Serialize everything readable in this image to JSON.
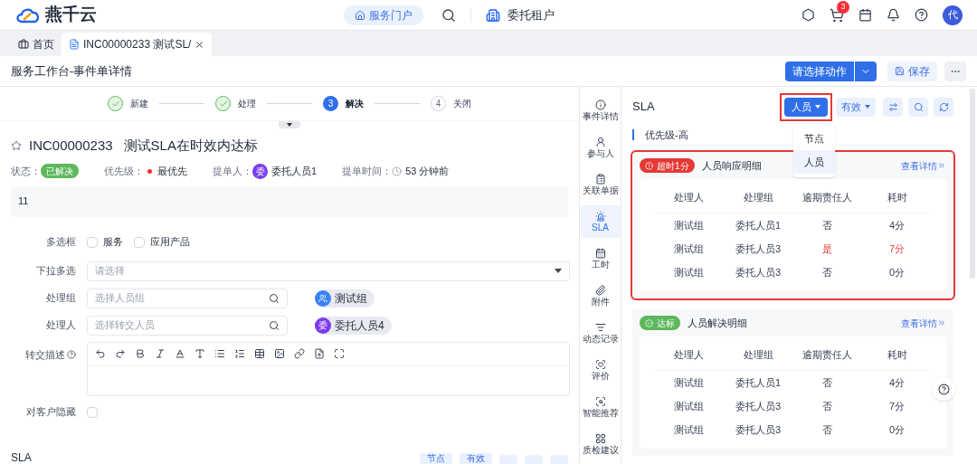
{
  "app": {
    "logo_text": "燕千云"
  },
  "top_bar": {
    "portal_button": "服务门户",
    "tenant": "委托租户",
    "cart_badge": "3",
    "avatar": "代"
  },
  "tabs": [
    {
      "label": "首页",
      "selected": false
    },
    {
      "label": "INC00000233 测试SL/",
      "selected": true
    }
  ],
  "page_header": {
    "title": "服务工作台-事件单详情",
    "action_button": "请选择动作",
    "save_button": "保存"
  },
  "steps": [
    {
      "label": "新建",
      "completed": true,
      "current": false
    },
    {
      "label": "处理",
      "completed": true,
      "current": false
    },
    {
      "number": "3",
      "label": "解决",
      "completed": false,
      "current": true
    },
    {
      "number": "4",
      "label": "关闭",
      "completed": false,
      "current": false
    }
  ],
  "ticket": {
    "starred": false,
    "id": "INC00000233",
    "title": "测试SLA在时效内达标",
    "status_label": "状态：",
    "status": "已解决",
    "priority_label": "优先级：",
    "priority": "最优先",
    "submitter_label": "提单人：",
    "submitter_avatar": "委",
    "submitter": "委托人员1",
    "time_label": "提单时间：",
    "time": "53 分钟前",
    "description": "11"
  },
  "form": [
    {
      "kind": "checkboxes",
      "label": "多选框",
      "options": [
        {
          "label": "服务",
          "checked": false
        },
        {
          "label": "应用产品",
          "checked": false
        }
      ]
    },
    {
      "kind": "select",
      "label": "下拉多选",
      "placeholder": "请选择"
    },
    {
      "kind": "search",
      "label": "处理组",
      "placeholder": "选择人员组",
      "chip": {
        "text": "测试组",
        "color": "#3b82f6"
      }
    },
    {
      "kind": "search",
      "label": "处理人",
      "placeholder": "选择转交人员",
      "chip": {
        "avatar_text": "委",
        "text": "委托人员4",
        "color": "#7c3aed"
      }
    },
    {
      "kind": "editor",
      "label": "转交描述"
    },
    {
      "kind": "checkbox",
      "label": "对客户隐藏",
      "checked": false
    }
  ],
  "bottom_sla": {
    "title": "SLA",
    "filter_buttons": [
      "节点",
      "有效"
    ]
  },
  "side_nav": [
    {
      "label": "事件详情",
      "selected": false
    },
    {
      "label": "参与人",
      "selected": false
    },
    {
      "label": "关联单据",
      "selected": false
    },
    {
      "label": "SLA",
      "selected": true
    },
    {
      "label": "工时",
      "selected": false
    },
    {
      "label": "附件",
      "selected": false
    },
    {
      "label": "动态记录",
      "selected": false
    },
    {
      "label": "评价",
      "selected": false
    },
    {
      "label": "智能推荐",
      "selected": false
    },
    {
      "label": "质检建议",
      "selected": false
    }
  ],
  "sla_panel": {
    "title": "SLA",
    "view_button": {
      "label": "人员",
      "highlighted": true
    },
    "status_button": "有效",
    "view_menu": [
      {
        "label": "节点",
        "selected": false
      },
      {
        "label": "人员",
        "selected": true
      }
    ],
    "priority": "优先级-高",
    "cards": [
      {
        "badge": "超时1分",
        "breached": true,
        "title": "人员响应明细",
        "link": "查看详情",
        "highlighted": true,
        "columns": [
          "处理人",
          "处理组",
          "逾期责任人",
          "耗时"
        ],
        "rows": [
          {
            "cells": [
              "测试组",
              "委托人员1",
              "否",
              "4分"
            ],
            "overdue": false
          },
          {
            "cells": [
              "测试组",
              "委托人员3",
              "是",
              "7分"
            ],
            "overdue": true
          },
          {
            "cells": [
              "测试组",
              "委托人员3",
              "否",
              "0分"
            ],
            "overdue": false
          }
        ]
      },
      {
        "badge": "达标",
        "breached": false,
        "title": "人员解决明细",
        "link": "查看详情",
        "highlighted": false,
        "columns": [
          "处理人",
          "处理组",
          "逾期责任人",
          "耗时"
        ],
        "rows": [
          {
            "cells": [
              "测试组",
              "委托人员1",
              "否",
              "4分"
            ],
            "overdue": false
          },
          {
            "cells": [
              "测试组",
              "委托人员3",
              "否",
              "7分"
            ],
            "overdue": false
          },
          {
            "cells": [
              "测试组",
              "委托人员3",
              "否",
              "0分"
            ],
            "overdue": false
          }
        ]
      }
    ]
  }
}
